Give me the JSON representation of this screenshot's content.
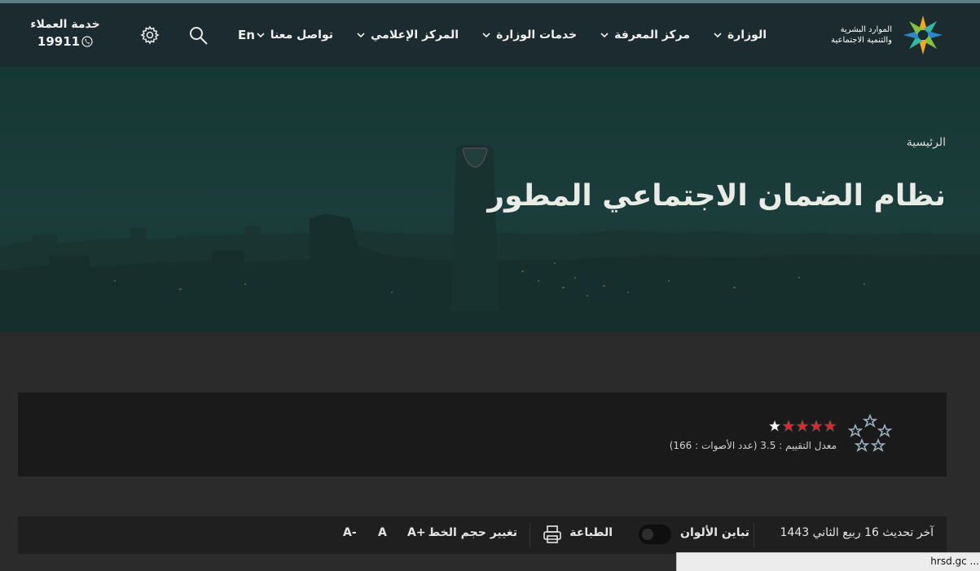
{
  "header": {
    "logo_text_line1": "الموارد البشرية",
    "logo_text_line2": "والتنمية الاجتماعية",
    "nav": [
      {
        "label": "الوزارة"
      },
      {
        "label": "مركز المعرفة"
      },
      {
        "label": "خدمات الوزارة"
      },
      {
        "label": "المركز الإعلامي"
      },
      {
        "label": "تواصل معنا"
      }
    ],
    "language_label": "En",
    "customer_service_title": "خدمة العملاء",
    "customer_service_number": "19911"
  },
  "hero": {
    "breadcrumb": "الرئيسية",
    "title": "نظام الضمان الاجتماعي المطور"
  },
  "rating": {
    "stars_value": 3.5,
    "stars_total": 5,
    "summary": "معدل التقييم : 3.5 (عدد الأصوات : 166)",
    "star_color": "#e0262b"
  },
  "tools": {
    "last_updated": "آخر تحديث 16 ربيع الثاني 1443",
    "contrast_label": "تباين الألوان",
    "print_label": "الطباعة",
    "font_size_label": "تغيير حجم الخط",
    "font_increase": "A+",
    "font_normal": "A",
    "font_decrease": "A-"
  },
  "status_bar": {
    "url_text": "hrsd.gc ..."
  },
  "colors": {
    "header_bg": "#1c2b2f",
    "hero_tint": "#1d3f3c",
    "page_bg": "#2b2b2b"
  }
}
